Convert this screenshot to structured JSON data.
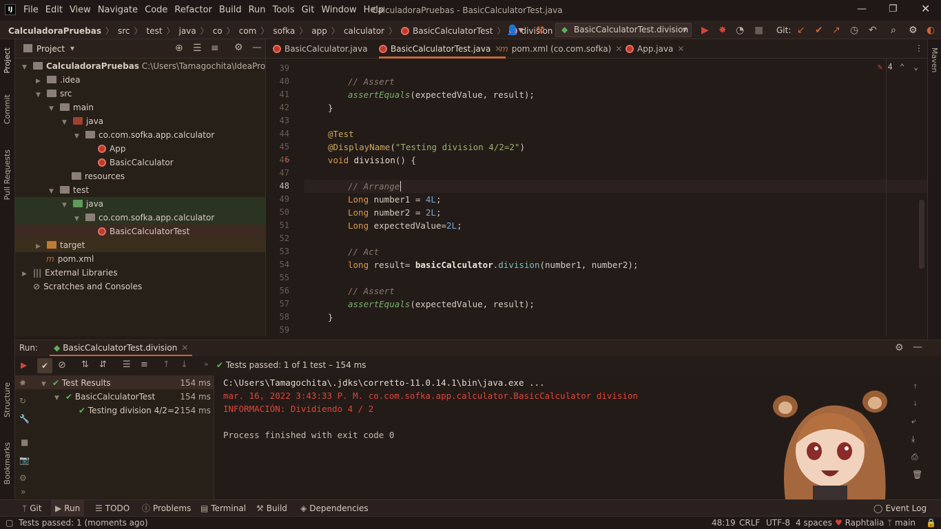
{
  "titlebar": {
    "menu": [
      "File",
      "Edit",
      "View",
      "Navigate",
      "Code",
      "Refactor",
      "Build",
      "Run",
      "Tools",
      "Git",
      "Window",
      "Help"
    ],
    "title": "CalculadoraPruebas - BasicCalculatorTest.java",
    "logo": "IJ"
  },
  "navbar": {
    "crumbs": [
      "CalculadoraPruebas",
      "src",
      "test",
      "java",
      "co",
      "com",
      "sofka",
      "app",
      "calculator",
      "BasicCalculatorTest",
      "division"
    ],
    "run_config": "BasicCalculatorTest.division",
    "git_label": "Git:"
  },
  "leftstrip": [
    "Project",
    "Commit",
    "Pull Requests",
    "Structure",
    "Bookmarks"
  ],
  "rightstrip": [
    "Maven"
  ],
  "project": {
    "header": "Project",
    "tree": [
      {
        "label": "CalculadoraPruebas",
        "extra": "C:\\Users\\Tamagochita\\IdeaProjects\\Ca"
      },
      {
        "label": ".idea"
      },
      {
        "label": "src"
      },
      {
        "label": "main"
      },
      {
        "label": "java"
      },
      {
        "label": "co.com.sofka.app.calculator"
      },
      {
        "label": "App"
      },
      {
        "label": "BasicCalculator"
      },
      {
        "label": "resources"
      },
      {
        "label": "test"
      },
      {
        "label": "java"
      },
      {
        "label": "co.com.sofka.app.calculator"
      },
      {
        "label": "BasicCalculatorTest"
      },
      {
        "label": "target"
      },
      {
        "label": "pom.xml"
      },
      {
        "label": "External Libraries"
      },
      {
        "label": "Scratches and Consoles"
      }
    ]
  },
  "tabs": [
    {
      "label": "BasicCalculator.java"
    },
    {
      "label": "BasicCalculatorTest.java"
    },
    {
      "label": "pom.xml (co.com.sofka)"
    },
    {
      "label": "App.java"
    }
  ],
  "editor": {
    "warnings": "4",
    "line_numbers": [
      "39",
      "40",
      "41",
      "42",
      "43",
      "44",
      "45",
      "46",
      "47",
      "48",
      "49",
      "50",
      "51",
      "52",
      "53",
      "54",
      "55",
      "56",
      "57",
      "58",
      "59"
    ],
    "lines": {
      "l40": "// Assert",
      "l41_fn": "assertEquals",
      "l41_rest": "(expectedValue, result);",
      "l42": "}",
      "l44": "@Test",
      "l45_ann": "@DisplayName",
      "l45_open": "(",
      "l45_str": "\"Testing division 4/2=2\"",
      "l45_close": ")",
      "l46_kw": "void",
      "l46_fn": "division",
      "l46_rest": "() {",
      "l48": "// Arrange",
      "l49_kw": "Long",
      "l49_a": " number1 = ",
      "l49_n": "4L",
      "l49_b": ";",
      "l50_kw": "Long",
      "l50_a": " number2 = ",
      "l50_n": "2L",
      "l50_b": ";",
      "l51_kw": "Long",
      "l51_a": " expectedValue=",
      "l51_n": "2L",
      "l51_b": ";",
      "l53": "// Act",
      "l54_kw": "long",
      "l54_a": " result= ",
      "l54_obj": "basicCalculator",
      "l54_dot": ".",
      "l54_m": "division",
      "l54_b": "(number1, number2);",
      "l56": "// Assert",
      "l57_fn": "assertEquals",
      "l57_rest": "(expectedValue, result);",
      "l58": "}"
    }
  },
  "run": {
    "label": "Run:",
    "tab": "BasicCalculatorTest.division",
    "summary_a": "Tests passed: ",
    "summary_b": "1 of 1 test – 154 ms",
    "tree": [
      {
        "label": "Test Results",
        "time": "154 ms"
      },
      {
        "label": "BasicCalculatorTest",
        "time": "154 ms"
      },
      {
        "label": "Testing division 4/2=2",
        "time": "154 ms"
      }
    ],
    "console": [
      "C:\\Users\\Tamagochita\\.jdks\\corretto-11.0.14.1\\bin\\java.exe ...",
      "mar. 16, 2022 3:43:33 P. M. co.com.sofka.app.calculator.BasicCalculator division",
      "INFORMACIÓN: Dividiendo 4 / 2",
      "Process finished with exit code 0"
    ]
  },
  "bottom_tabs": [
    "Git",
    "Run",
    "TODO",
    "Problems",
    "Terminal",
    "Build",
    "Dependencies"
  ],
  "event_log": "Event Log",
  "status": {
    "left": "Tests passed: 1 (moments ago)",
    "position": "48:19",
    "line_sep": "CRLF",
    "encoding": "UTF-8",
    "indent": "4 spaces",
    "theme": "Raphtalia",
    "branch": "main"
  }
}
